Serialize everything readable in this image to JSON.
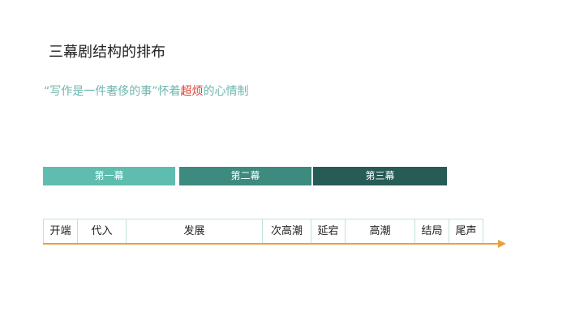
{
  "title": "三幕剧结构的排布",
  "subtitle": {
    "prefix": "“写作是一件奢侈的事”怀着",
    "highlight": "超烦",
    "suffix": "的心情制"
  },
  "acts": [
    {
      "label": "第一幕",
      "color": "#5fbdb0"
    },
    {
      "label": "第二幕",
      "color": "#3d8a7f"
    },
    {
      "label": "第三幕",
      "color": "#275b55"
    }
  ],
  "stages": [
    {
      "label": "开端"
    },
    {
      "label": "代入"
    },
    {
      "label": "发展"
    },
    {
      "label": "次高潮"
    },
    {
      "label": "延宕"
    },
    {
      "label": "高潮"
    },
    {
      "label": "结局"
    },
    {
      "label": "尾声"
    }
  ],
  "colors": {
    "subtitle": "#6fb6ae",
    "highlight": "#e23a2e",
    "arrow": "#e8a23a",
    "stage_border": "#bfe3dc"
  }
}
